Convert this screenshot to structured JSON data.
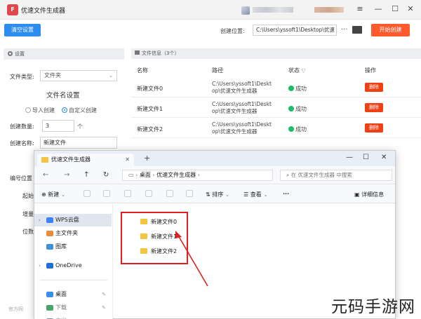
{
  "app": {
    "title": "优速文件生成器",
    "logo_text": "F",
    "window_controls": {
      "menu": "≡",
      "minimize": "—",
      "maximize": "☐",
      "close": "✕"
    }
  },
  "toolbar": {
    "clear_label": "清空设置",
    "location_label": "创建位置:",
    "location_value": "C:\\Users\\yssoft1\\Desktop\\优速",
    "more_label": "···",
    "start_label": "开始创建"
  },
  "settings": {
    "header": "设置",
    "file_type_label": "文件类型:",
    "file_type_value": "文件夹",
    "section_title": "文件名设置",
    "radio_import": "导入创建",
    "radio_custom": "自定义创建",
    "count_label": "创建数量:",
    "count_value": "3",
    "count_unit": "个",
    "name_label": "创建名称:",
    "name_value": "新建文件",
    "hidden_labels": [
      "编号位置",
      "起始",
      "增量",
      "位数"
    ],
    "footer_hint": "官方网"
  },
  "file_list": {
    "header": "文件信息（3个）",
    "columns": [
      "名称",
      "路径",
      "状态",
      "操作"
    ],
    "rows": [
      {
        "name": "新建文件0",
        "path_line1": "C:\\Users\\yssoft1\\Deskt",
        "path_line2": "op\\优速文件生成器",
        "status": "成功",
        "action": "删除"
      },
      {
        "name": "新建文件1",
        "path_line1": "C:\\Users\\yssoft1\\Deskt",
        "path_line2": "op\\优速文件生成器",
        "status": "成功",
        "action": "删除"
      },
      {
        "name": "新建文件2",
        "path_line1": "C:\\Users\\yssoft1\\Deskt",
        "path_line2": "op\\优速文件生成器",
        "status": "成功",
        "action": "删除"
      }
    ]
  },
  "explorer": {
    "tab_title": "优速文件生成器",
    "breadcrumb": [
      "桌面",
      "优速文件生成器"
    ],
    "search_placeholder": "在 优速文件生成器 中搜索",
    "commands": {
      "new": "新建",
      "sort": "排序",
      "view": "查看",
      "more": "···",
      "details": "详细信息"
    },
    "nav_items": [
      "WPS云盘",
      "主文件夹",
      "图库",
      "OneDrive",
      "桌面",
      "下载",
      "文档"
    ],
    "files": [
      "新建文件0",
      "新建文件1",
      "新建文件2"
    ]
  },
  "watermark": "元码手游网",
  "colors": {
    "primary": "#2d8cf0",
    "start": "#ff5a2c",
    "delete": "#ed4014",
    "success": "#19be6b",
    "highlight": "#e02020",
    "folder": "#f4c542"
  }
}
